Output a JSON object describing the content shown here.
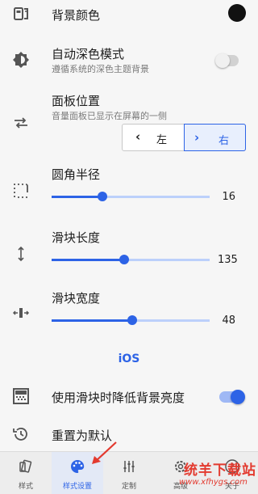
{
  "settings": {
    "bg_color": {
      "label": "背景颜色",
      "value_color": "#111111"
    },
    "auto_dark": {
      "label": "自动深色模式",
      "sub": "遵循系统的深色主题背景",
      "enabled": false
    },
    "panel_position": {
      "label": "面板位置",
      "sub": "音量面板已显示在屏幕的一侧",
      "left_label": "左",
      "right_label": "右",
      "selected": "右"
    },
    "corner_radius": {
      "label": "圆角半径",
      "value": "16",
      "fraction": 0.32
    },
    "slider_length": {
      "label": "滑块长度",
      "value": "135",
      "fraction": 0.46
    },
    "slider_width": {
      "label": "滑块宽度",
      "value": "48",
      "fraction": 0.51
    },
    "ios_link": "iOS",
    "dim_background": {
      "label": "使用滑块时降低背景亮度",
      "enabled": true
    },
    "reset": {
      "label": "重置为默认"
    }
  },
  "nav": {
    "items": [
      {
        "label": "样式",
        "icon": "styles-icon",
        "active": false
      },
      {
        "label": "样式设置",
        "icon": "palette-icon",
        "active": true
      },
      {
        "label": "定制",
        "icon": "sliders-icon",
        "active": false
      },
      {
        "label": "高级",
        "icon": "gear-icon",
        "active": false
      },
      {
        "label": "关于",
        "icon": "help-icon",
        "active": false
      }
    ]
  },
  "watermark": {
    "text": "统羊下载站",
    "url": "www.xfhygs.com"
  },
  "colors": {
    "accent": "#2d63e6",
    "watermark": "#e33a2f"
  }
}
